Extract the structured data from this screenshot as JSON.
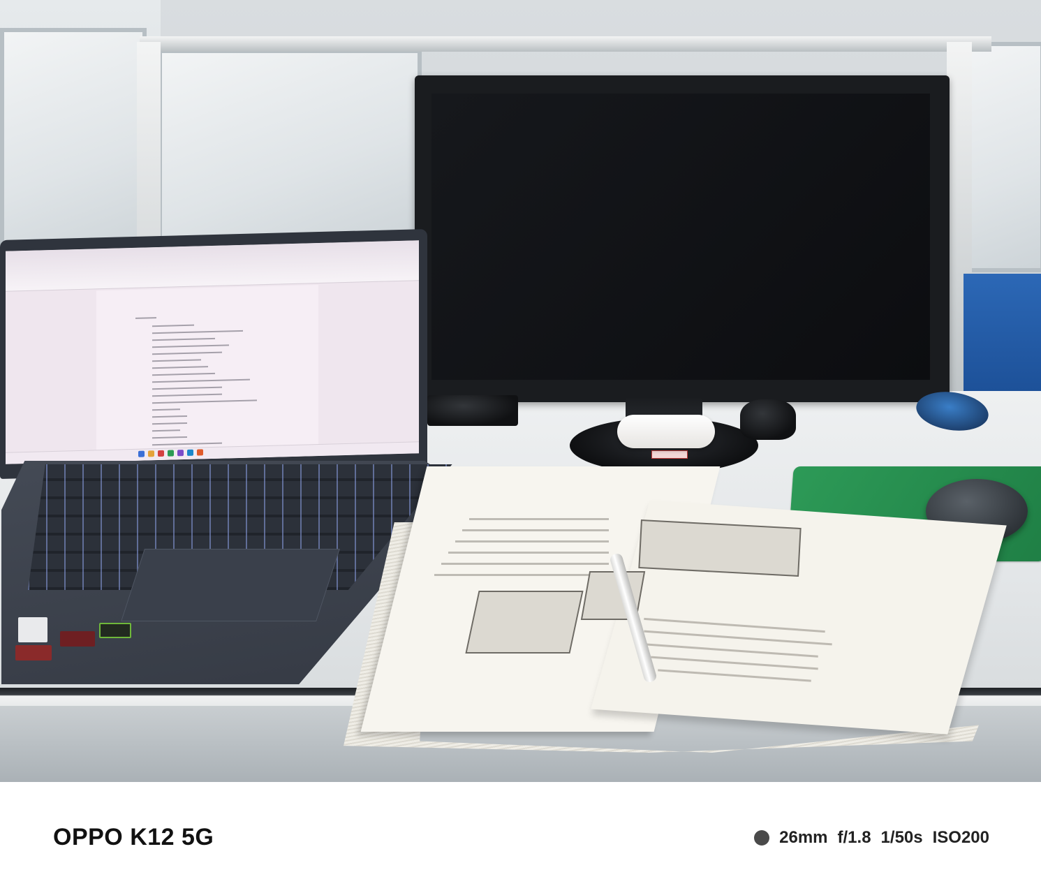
{
  "photo": {
    "subject": ""
  },
  "caption": {
    "device": "OPPO K12 5G",
    "focal_length": "26mm",
    "aperture": "f/1.8",
    "shutter": "1/50s",
    "iso": "ISO200"
  },
  "colors": {
    "mousepad": "#2d9a57",
    "cubicle_panel": "#2c68b6",
    "laptop_body": "#3a3f4a"
  }
}
